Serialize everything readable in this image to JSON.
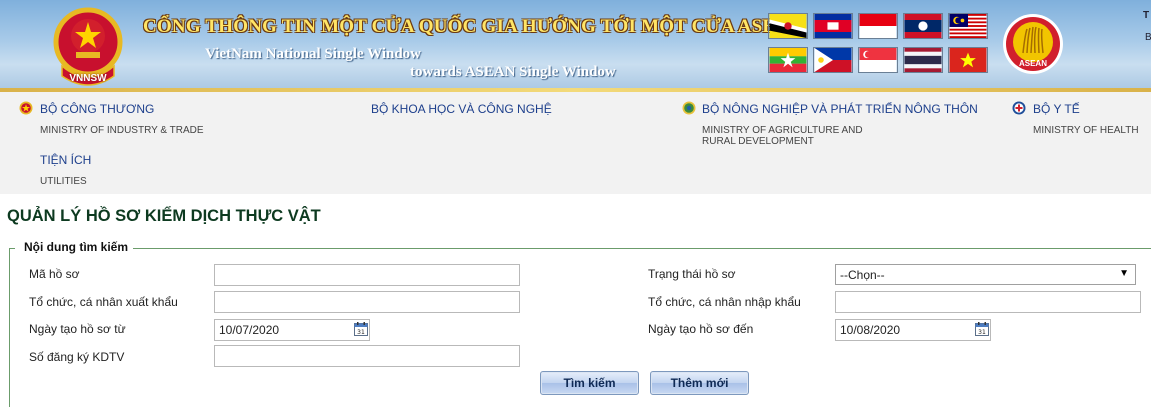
{
  "banner": {
    "logo_text": "VNNSW",
    "title": "CỔNG THÔNG TIN MỘT CỬA QUỐC GIA HƯỚNG TỚI MỘT CỬA ASEAN",
    "subtitle_line1": "VietNam National Single Window",
    "subtitle_line2": "towards ASEAN Single Window",
    "asean_logo_text": "ASEAN",
    "flags": [
      "brunei-flag",
      "cambodia-flag",
      "indonesia-flag",
      "laos-flag",
      "malaysia-flag",
      "myanmar-flag",
      "philippines-flag",
      "singapore-flag",
      "thailand-flag",
      "vietnam-flag"
    ],
    "corner_text_1": "T",
    "corner_text_2": "B"
  },
  "menu": {
    "items": [
      {
        "label": "BỘ CÔNG THƯƠNG",
        "sub": "MINISTRY OF INDUSTRY & TRADE",
        "icon": "ministry-emblem-icon"
      },
      {
        "label": "BỘ KHOA HỌC VÀ CÔNG NGHỆ",
        "sub": ""
      },
      {
        "label": "BỘ NÔNG NGHIỆP VÀ PHÁT TRIỂN NÔNG THÔN",
        "sub_line1": "MINISTRY OF AGRICULTURE AND",
        "sub_line2": "RURAL DEVELOPMENT",
        "icon": "agriculture-emblem-icon"
      },
      {
        "label": "BỘ Y TẾ",
        "sub": "MINISTRY OF HEALTH",
        "icon": "health-emblem-icon"
      },
      {
        "label": "TIỆN ÍCH",
        "sub": "UTILITIES"
      }
    ]
  },
  "page": {
    "title": "QUẢN LÝ HỒ SƠ KIỂM DỊCH THỰC VẬT"
  },
  "search": {
    "legend": "Nội dung tìm kiếm",
    "fields": {
      "record_code": {
        "label": "Mã hồ sơ",
        "value": ""
      },
      "exporter": {
        "label": "Tổ chức, cá nhân xuất khẩu",
        "value": ""
      },
      "created_from": {
        "label": "Ngày tạo hồ sơ từ",
        "value": "10/07/2020"
      },
      "registration_no": {
        "label": "Số đăng ký KDTV",
        "value": ""
      },
      "status": {
        "label": "Trạng thái hồ sơ",
        "value": "--Chọn--"
      },
      "importer": {
        "label": "Tổ chức, cá nhân nhập khẩu",
        "value": ""
      },
      "created_to": {
        "label": "Ngày tạo hồ sơ đến",
        "value": "10/08/2020"
      }
    },
    "buttons": {
      "search": "Tìm kiếm",
      "add_new": "Thêm mới"
    }
  },
  "colors": {
    "menu_link": "#1d3f8c",
    "page_title": "#0d3a20",
    "fieldset_border": "#6b9c6b",
    "button_text": "#0f2a55"
  }
}
